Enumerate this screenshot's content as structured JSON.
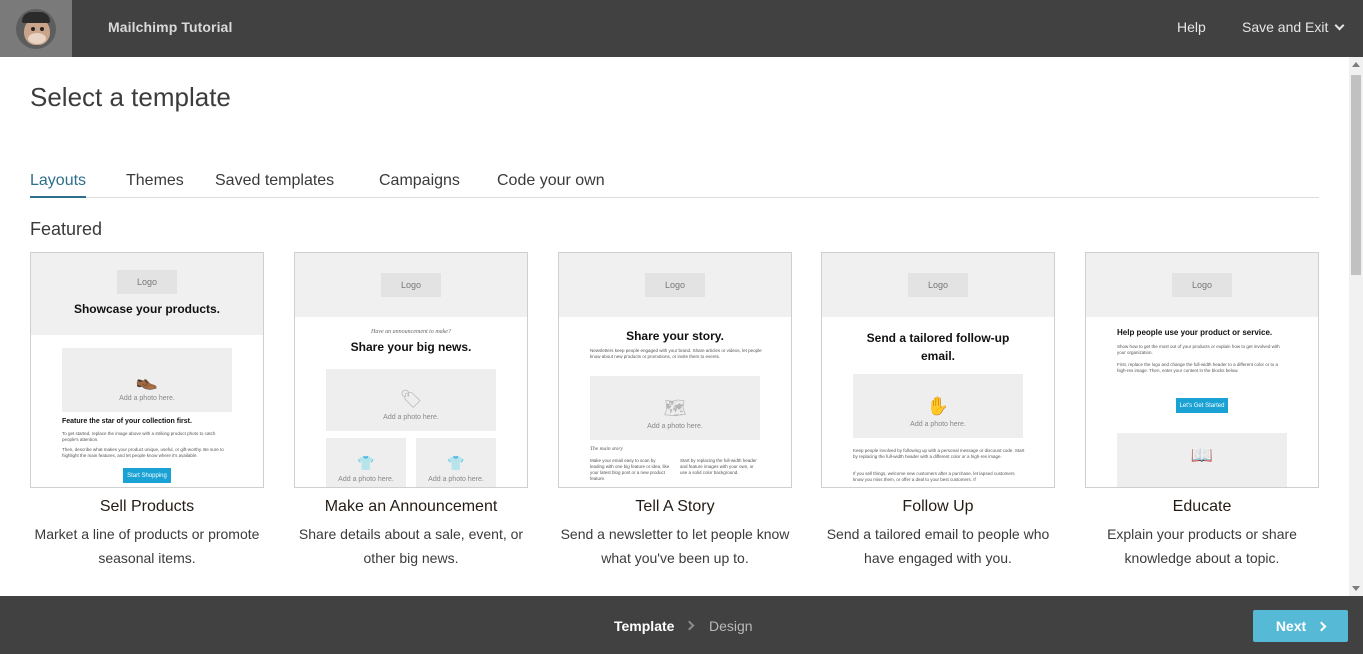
{
  "header": {
    "app_title": "Mailchimp Tutorial",
    "help_label": "Help",
    "save_exit_label": "Save and Exit"
  },
  "main": {
    "title": "Select a template",
    "tabs": [
      {
        "label": "Layouts"
      },
      {
        "label": "Themes"
      },
      {
        "label": "Saved templates"
      },
      {
        "label": "Campaigns"
      },
      {
        "label": "Code your own"
      }
    ],
    "section_title": "Featured",
    "cards": [
      {
        "title": "Sell Products",
        "description": "Market a line of products or promote seasonal items.",
        "preview": {
          "logo": "Logo",
          "headline": "Showcase your products.",
          "photo": "Add a photo here.",
          "subhead": "Feature the star of your collection first.",
          "body1": "To get started, replace the image above with a striking product photo to catch people's attention.",
          "body2": "Then, describe what makes your product unique, useful, or gift-worthy. Be sure to highlight the main features, and let people know where it's available.",
          "button": "Start Shopping"
        }
      },
      {
        "title": "Make an Announcement",
        "description": "Share details about a sale, event, or other big news.",
        "preview": {
          "logo": "Logo",
          "kicker": "Have an announcement to make?",
          "headline": "Share your big news.",
          "photo": "Add a photo here.",
          "photo_small_1": "Add a photo here.",
          "photo_small_2": "Add a photo here."
        }
      },
      {
        "title": "Tell A Story",
        "description": "Send a newsletter to let people know what you've been up to.",
        "preview": {
          "logo": "Logo",
          "headline": "Share your story.",
          "body": "Newsletters keep people engaged with your brand. Share articles or videos, let people know about new products or promotions, or invite them to events.",
          "photo": "Add a photo here.",
          "section": "The main story",
          "col1": "Make your email easy to scan by leading with one big feature or idea, like your latest blog post or a new product feature.",
          "col2": "Start by replacing the full-width header and feature images with your own, or use a solid color background."
        }
      },
      {
        "title": "Follow Up",
        "description": "Send a tailored email to people who have engaged with you.",
        "preview": {
          "logo": "Logo",
          "headline": "Send a tailored follow-up email.",
          "photo": "Add a photo here.",
          "body1": "Keep people involved by following up with a personal message or discount code. Start by replacing the full-width header with a different color or a high-res image.",
          "body2": "If you sell things, welcome new customers after a purchase, let lapsed customers know you miss them, or offer a deal to your best customers. If"
        }
      },
      {
        "title": "Educate",
        "description": "Explain your products or share knowledge about a topic.",
        "preview": {
          "logo": "Logo",
          "headline": "Help people use your product or service.",
          "body1": "Show how to get the most out of your products or explain how to get involved with your organization.",
          "body2": "First, replace the logo and change the full-width header to a different color or to a high-res image. Then, enter your content in the blocks below.",
          "button": "Let's Get Started"
        }
      }
    ]
  },
  "footer": {
    "step_current": "Template",
    "step_next": "Design",
    "next_label": "Next"
  },
  "colors": {
    "topbar": "#414141",
    "active_tab": "#2d6f8c",
    "next_button": "#56b9d6",
    "template_button": "#1aa2d4"
  }
}
